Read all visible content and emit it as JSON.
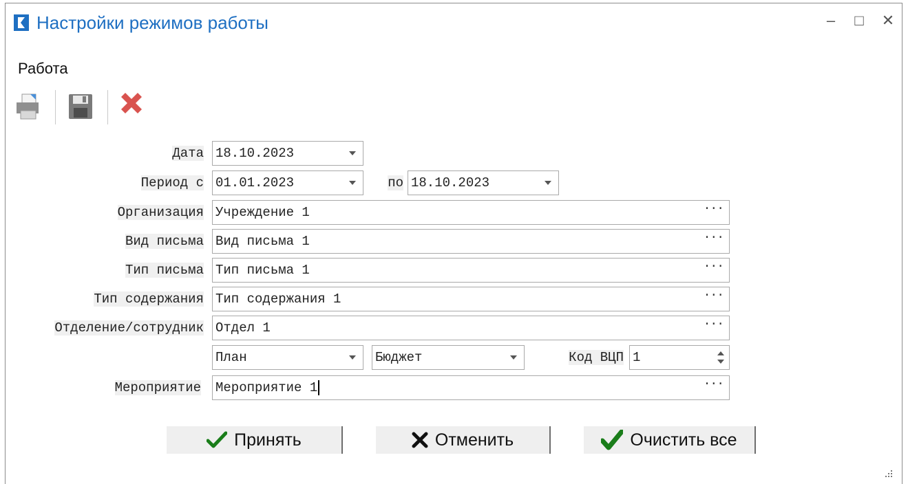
{
  "window": {
    "title": "Настройки режимов работы",
    "minimize": "–",
    "maximize": "□",
    "close": "✕"
  },
  "menu": {
    "items": [
      {
        "label": "Работа"
      }
    ]
  },
  "toolbar": {
    "icons": [
      "print-icon",
      "save-icon",
      "delete-icon"
    ]
  },
  "form": {
    "date_label": "Дата",
    "date_value": "18.10.2023",
    "period_from_label": "Период с",
    "period_from_value": "01.01.2023",
    "period_to_label": "по",
    "period_to_value": "18.10.2023",
    "org_label": "Организация",
    "org_value": "Учреждение 1",
    "letter_kind_label": "Вид письма",
    "letter_kind_value": "Вид письма 1",
    "letter_type_label": "Тип письма",
    "letter_type_value": "Тип письма 1",
    "content_type_label": "Тип содержания",
    "content_type_value": "Тип содержания 1",
    "department_label": "Отделение/сотрудник",
    "department_value": "Отдел 1",
    "plan_value": "План",
    "budget_value": "Бюджет",
    "code_label": "Код ВЦП",
    "code_value": "1",
    "event_label": "Мероприятие",
    "event_value": "Мероприятие 1",
    "ellipsis": "···"
  },
  "buttons": {
    "accept": "Принять",
    "cancel": "Отменить",
    "clear": "Очистить все"
  },
  "colors": {
    "title": "#1e6fc2",
    "check": "#1a7d1a",
    "delete": "#d9534f"
  }
}
